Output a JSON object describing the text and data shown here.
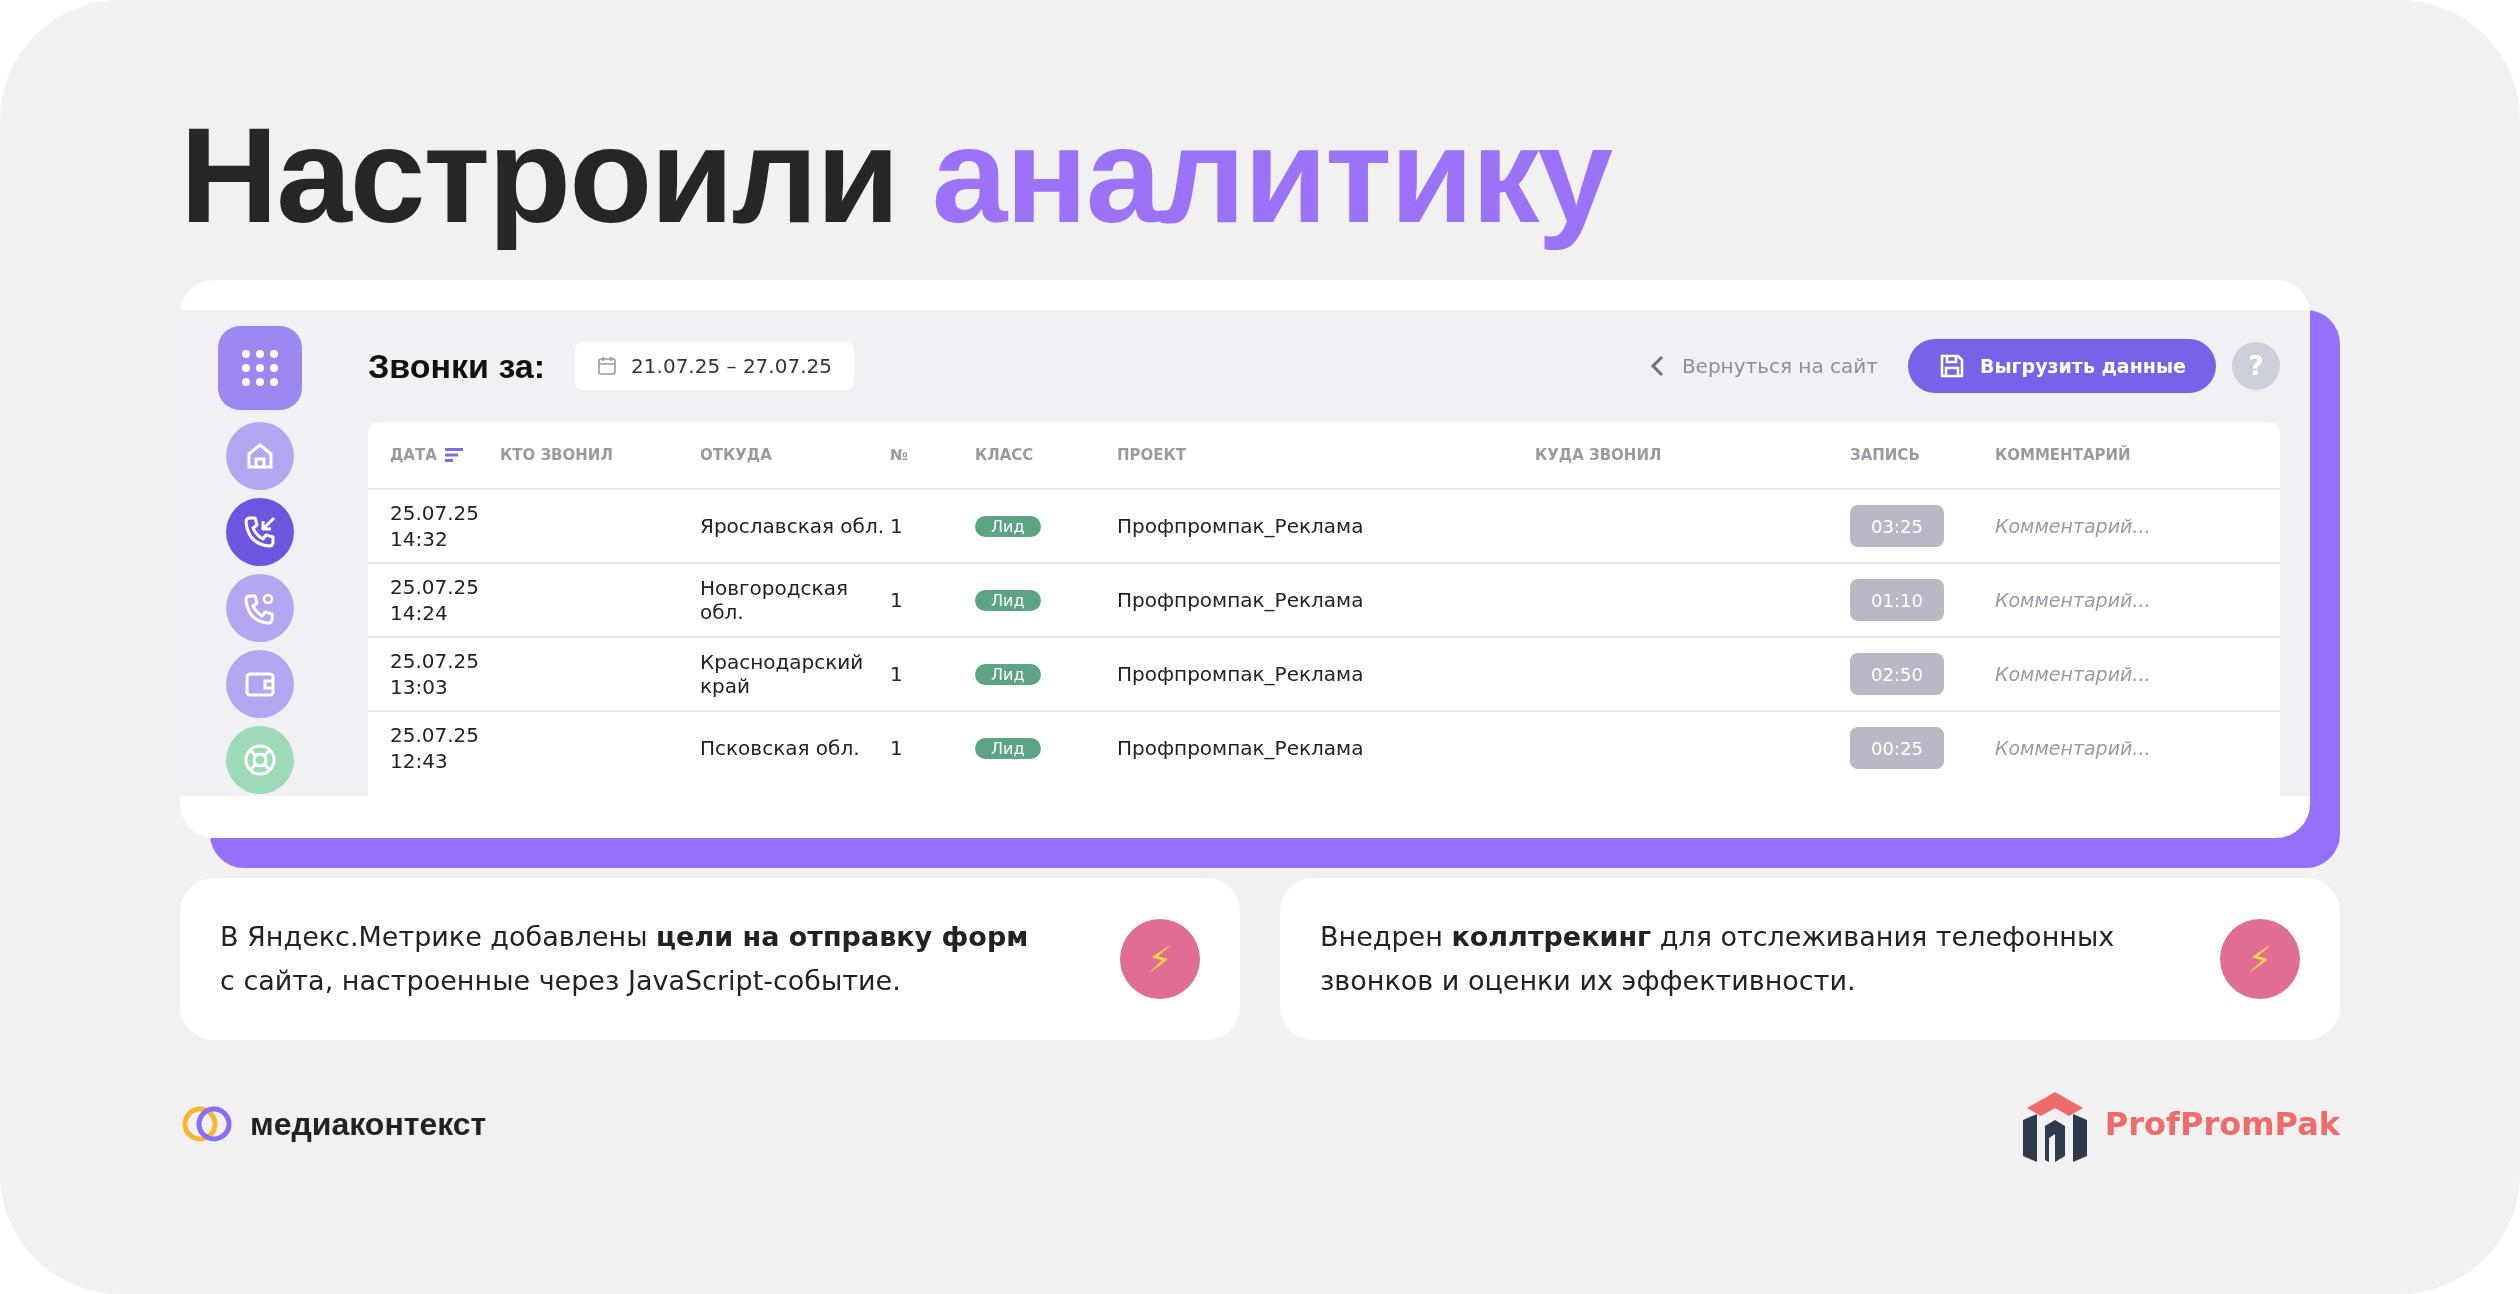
{
  "headline": [
    {
      "text": "Настроили",
      "accent": false
    },
    {
      "text": "аналитику",
      "accent": true
    }
  ],
  "app": {
    "sidebar": [
      {
        "selected": false
      },
      {
        "selected": false
      },
      {
        "selected": true
      },
      {
        "selected": false
      },
      {
        "selected": false
      },
      {
        "selected": false
      }
    ],
    "heading": "Звонки за:",
    "date_range": "21.07.25 – 27.07.25",
    "back_link": "Вернуться на сайт",
    "export_button": "Выгрузить данные",
    "help_button": "?",
    "table": {
      "columns": [
        "ДАТА",
        "КТО ЗВОНИЛ",
        "ОТКУДА",
        "№",
        "КЛАСС",
        "ПРОЕКТ",
        "КУДА ЗВОНИЛ",
        "ЗАПИСЬ",
        "КОММЕНТАРИЙ"
      ],
      "rows": [
        {
          "date": "25.07.25",
          "time": "14:32",
          "from": "Ярославская обл.",
          "number": "1",
          "class": "Лид",
          "project": "Профпромпак_Реклама",
          "record": "03:25",
          "comment_placeholder": "Комментарий..."
        },
        {
          "date": "25.07.25",
          "time": "14:24",
          "from": "Новгородская обл.",
          "number": "1",
          "class": "Лид",
          "project": "Профпромпак_Реклама",
          "record": "01:10",
          "comment_placeholder": "Комментарий..."
        },
        {
          "date": "25.07.25",
          "time": "13:03",
          "from": "Краснодарский край",
          "number": "1",
          "class": "Лид",
          "project": "Профпромпак_Реклама",
          "record": "02:50",
          "comment_placeholder": "Комментарий..."
        },
        {
          "date": "25.07.25",
          "time": "12:43",
          "from": "Псковская обл.",
          "number": "1",
          "class": "Лид",
          "project": "Профпромпак_Реклама",
          "record": "00:25",
          "comment_placeholder": "Комментарий..."
        }
      ]
    }
  },
  "notes": [
    {
      "text": "В Яндекс.Метрике добавлены **цели на отправку форм** с сайта, настроенные через JavaScript-событие.",
      "icon": "⚡"
    },
    {
      "text": "Внедрен **коллтрекинг** для отслеживания телефонных звонков и оценки их эффективности.",
      "icon": "⚡"
    }
  ],
  "footer": {
    "agency": "медиаконтекст",
    "client": "ProfPromPak"
  }
}
